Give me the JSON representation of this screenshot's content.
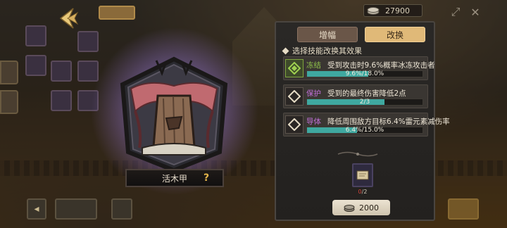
{
  "currency": {
    "amount": "27900",
    "icon": "coin-stack-icon"
  },
  "character": {
    "name": "活木甲",
    "help": "?"
  },
  "panel": {
    "tabs": [
      {
        "label": "增幅",
        "active": false
      },
      {
        "label": "改换",
        "active": true
      }
    ],
    "title": "选择技能改换其效果",
    "effects": [
      {
        "name": "冻结",
        "desc": "受到攻击时9.6%概率冰冻攻击者",
        "progress": "9.6%/18.0%",
        "fill": 0.53,
        "name_color": "#8ec04a",
        "selected": true
      },
      {
        "name": "保护",
        "desc": "受到的最终伤害降低2点",
        "progress": "2/3",
        "fill": 0.67,
        "name_color": "#c070d8",
        "selected": false
      },
      {
        "name": "导体",
        "desc": "降低周围敌方目标6.4%雷元素减伤率",
        "progress": "6.4%/15.0%",
        "fill": 0.43,
        "name_color": "#c070d8",
        "selected": false
      }
    ],
    "material": {
      "have": "0",
      "need": "/2",
      "icon": "scroll-icon"
    },
    "cost": {
      "amount": "2000",
      "icon": "coin-stack-icon"
    }
  },
  "colors": {
    "accent": "#e0b978",
    "bar": "#3fa8a0",
    "select": "#7ea43e"
  }
}
